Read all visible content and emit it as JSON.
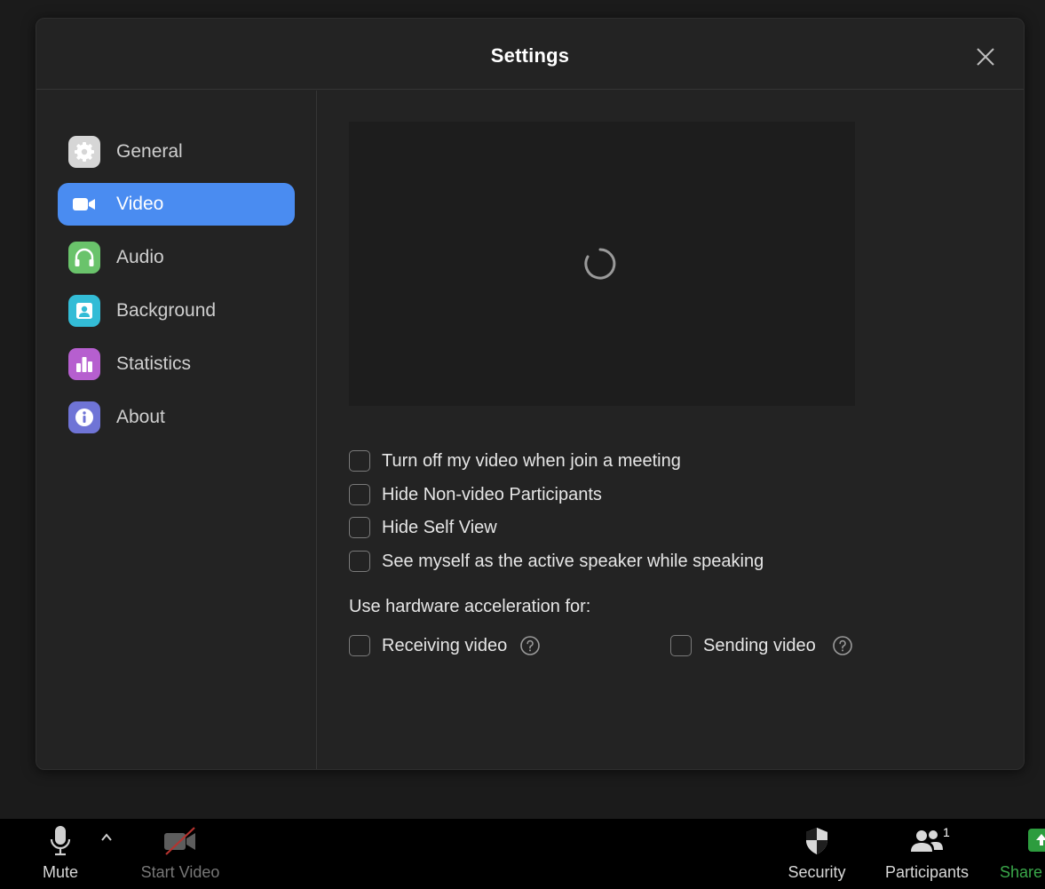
{
  "dialog": {
    "title": "Settings"
  },
  "sidebar": {
    "items": [
      {
        "label": "General",
        "icon": "gear-icon",
        "color": "#d8d8d8"
      },
      {
        "label": "Video",
        "icon": "video-camera-icon",
        "color": "#4a8cf1",
        "active": true
      },
      {
        "label": "Audio",
        "icon": "headphones-icon",
        "color": "#6ac36b"
      },
      {
        "label": "Background",
        "icon": "background-portrait-icon",
        "color": "#33bcd6"
      },
      {
        "label": "Statistics",
        "icon": "bar-chart-icon",
        "color": "#b65fcf"
      },
      {
        "label": "About",
        "icon": "info-icon",
        "color": "#6f74d6"
      }
    ]
  },
  "video": {
    "preview_loading": true,
    "options": [
      {
        "label": "Turn off my video when join a meeting",
        "checked": false
      },
      {
        "label": "Hide Non-video Participants",
        "checked": false
      },
      {
        "label": "Hide Self View",
        "checked": false
      },
      {
        "label": "See myself as the active speaker while speaking",
        "checked": false
      }
    ],
    "hw_accel_label": "Use hardware acceleration for:",
    "hw_accel": {
      "receiving": {
        "label": "Receiving video",
        "checked": false
      },
      "sending": {
        "label": "Sending video",
        "checked": false
      }
    }
  },
  "toolbar": {
    "mute": "Mute",
    "start_video": "Start Video",
    "security": "Security",
    "participants": "Participants",
    "participants_count": "1",
    "share": "Share"
  },
  "colors": {
    "accent": "#4a8cf1",
    "dialog_bg": "#232323",
    "share_green": "#3aa84a"
  }
}
